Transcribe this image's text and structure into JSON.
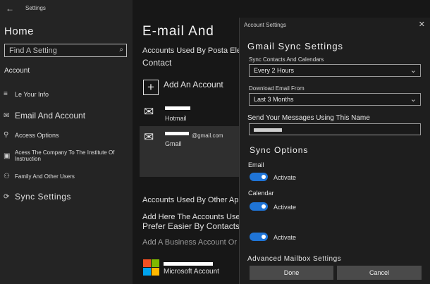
{
  "sidebar": {
    "back": "←",
    "app_title": "Settings",
    "home": "Home",
    "search_placeholder": "Find A Setting",
    "search_icon": "⌕",
    "section": "Account",
    "items": [
      {
        "icon": "≡",
        "label": "Le Your Info"
      },
      {
        "icon": "✉",
        "label": "Email And Account"
      },
      {
        "icon": "⚲",
        "label": "Access Options"
      },
      {
        "icon": "▣",
        "label": "Acess The Company To The Institute Of Instruction"
      },
      {
        "icon": "⚇",
        "label": "Family And Other Users"
      },
      {
        "icon": "⟳",
        "label": "Sync Settings"
      }
    ]
  },
  "main": {
    "title": "E-mail And",
    "accounts_heading_1": "Accounts Used By Posta Ele",
    "accounts_heading_2": "Contact",
    "add_account": "Add An Account",
    "accounts": [
      {
        "label": "Hotmail"
      },
      {
        "label": "Gmail",
        "domain": "@gmail.com"
      }
    ],
    "other_apps_heading": "Accounts Used By Other App",
    "other_line_1": "Add Here The Accounts Used For",
    "other_line_2": "Prefer Easier By Contacts",
    "business": "Add A Business Account Or",
    "microsoft": "Microsoft Account"
  },
  "dialog": {
    "title": "Account Settings",
    "close": "✕",
    "heading": "Gmail Sync Settings",
    "sync_label": "Sync Contacts And Calendars",
    "sync_value": "Every 2 Hours",
    "download_label": "Download Email From",
    "download_value": "Last 3 Months",
    "send_label": "Send Your Messages Using This Name",
    "sync_options": "Sync Options",
    "email_label": "Email",
    "calendar_label": "Calendar",
    "activate": "Activate",
    "advanced": "Advanced Mailbox Settings",
    "done": "Done",
    "cancel": "Cancel",
    "toggle_color": "#1f74d6"
  }
}
